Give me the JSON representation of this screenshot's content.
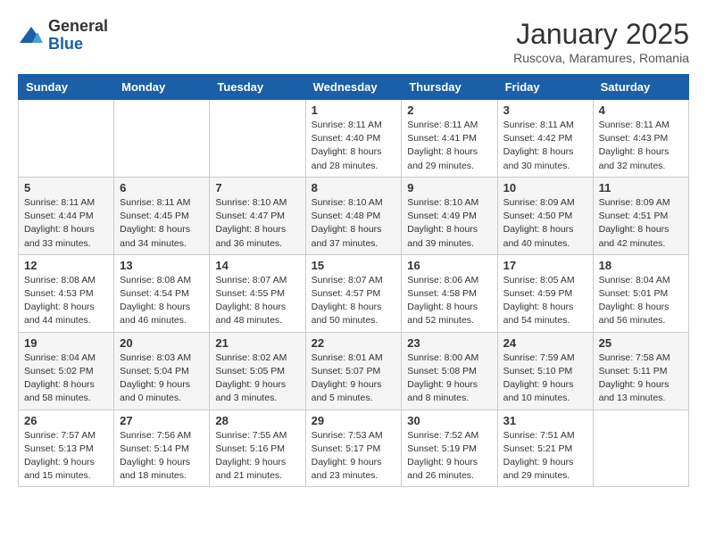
{
  "logo": {
    "general": "General",
    "blue": "Blue"
  },
  "header": {
    "month": "January 2025",
    "location": "Ruscova, Maramures, Romania"
  },
  "weekdays": [
    "Sunday",
    "Monday",
    "Tuesday",
    "Wednesday",
    "Thursday",
    "Friday",
    "Saturday"
  ],
  "weeks": [
    [
      {
        "day": "",
        "info": ""
      },
      {
        "day": "",
        "info": ""
      },
      {
        "day": "",
        "info": ""
      },
      {
        "day": "1",
        "info": "Sunrise: 8:11 AM\nSunset: 4:40 PM\nDaylight: 8 hours\nand 28 minutes."
      },
      {
        "day": "2",
        "info": "Sunrise: 8:11 AM\nSunset: 4:41 PM\nDaylight: 8 hours\nand 29 minutes."
      },
      {
        "day": "3",
        "info": "Sunrise: 8:11 AM\nSunset: 4:42 PM\nDaylight: 8 hours\nand 30 minutes."
      },
      {
        "day": "4",
        "info": "Sunrise: 8:11 AM\nSunset: 4:43 PM\nDaylight: 8 hours\nand 32 minutes."
      }
    ],
    [
      {
        "day": "5",
        "info": "Sunrise: 8:11 AM\nSunset: 4:44 PM\nDaylight: 8 hours\nand 33 minutes."
      },
      {
        "day": "6",
        "info": "Sunrise: 8:11 AM\nSunset: 4:45 PM\nDaylight: 8 hours\nand 34 minutes."
      },
      {
        "day": "7",
        "info": "Sunrise: 8:10 AM\nSunset: 4:47 PM\nDaylight: 8 hours\nand 36 minutes."
      },
      {
        "day": "8",
        "info": "Sunrise: 8:10 AM\nSunset: 4:48 PM\nDaylight: 8 hours\nand 37 minutes."
      },
      {
        "day": "9",
        "info": "Sunrise: 8:10 AM\nSunset: 4:49 PM\nDaylight: 8 hours\nand 39 minutes."
      },
      {
        "day": "10",
        "info": "Sunrise: 8:09 AM\nSunset: 4:50 PM\nDaylight: 8 hours\nand 40 minutes."
      },
      {
        "day": "11",
        "info": "Sunrise: 8:09 AM\nSunset: 4:51 PM\nDaylight: 8 hours\nand 42 minutes."
      }
    ],
    [
      {
        "day": "12",
        "info": "Sunrise: 8:08 AM\nSunset: 4:53 PM\nDaylight: 8 hours\nand 44 minutes."
      },
      {
        "day": "13",
        "info": "Sunrise: 8:08 AM\nSunset: 4:54 PM\nDaylight: 8 hours\nand 46 minutes."
      },
      {
        "day": "14",
        "info": "Sunrise: 8:07 AM\nSunset: 4:55 PM\nDaylight: 8 hours\nand 48 minutes."
      },
      {
        "day": "15",
        "info": "Sunrise: 8:07 AM\nSunset: 4:57 PM\nDaylight: 8 hours\nand 50 minutes."
      },
      {
        "day": "16",
        "info": "Sunrise: 8:06 AM\nSunset: 4:58 PM\nDaylight: 8 hours\nand 52 minutes."
      },
      {
        "day": "17",
        "info": "Sunrise: 8:05 AM\nSunset: 4:59 PM\nDaylight: 8 hours\nand 54 minutes."
      },
      {
        "day": "18",
        "info": "Sunrise: 8:04 AM\nSunset: 5:01 PM\nDaylight: 8 hours\nand 56 minutes."
      }
    ],
    [
      {
        "day": "19",
        "info": "Sunrise: 8:04 AM\nSunset: 5:02 PM\nDaylight: 8 hours\nand 58 minutes."
      },
      {
        "day": "20",
        "info": "Sunrise: 8:03 AM\nSunset: 5:04 PM\nDaylight: 9 hours\nand 0 minutes."
      },
      {
        "day": "21",
        "info": "Sunrise: 8:02 AM\nSunset: 5:05 PM\nDaylight: 9 hours\nand 3 minutes."
      },
      {
        "day": "22",
        "info": "Sunrise: 8:01 AM\nSunset: 5:07 PM\nDaylight: 9 hours\nand 5 minutes."
      },
      {
        "day": "23",
        "info": "Sunrise: 8:00 AM\nSunset: 5:08 PM\nDaylight: 9 hours\nand 8 minutes."
      },
      {
        "day": "24",
        "info": "Sunrise: 7:59 AM\nSunset: 5:10 PM\nDaylight: 9 hours\nand 10 minutes."
      },
      {
        "day": "25",
        "info": "Sunrise: 7:58 AM\nSunset: 5:11 PM\nDaylight: 9 hours\nand 13 minutes."
      }
    ],
    [
      {
        "day": "26",
        "info": "Sunrise: 7:57 AM\nSunset: 5:13 PM\nDaylight: 9 hours\nand 15 minutes."
      },
      {
        "day": "27",
        "info": "Sunrise: 7:56 AM\nSunset: 5:14 PM\nDaylight: 9 hours\nand 18 minutes."
      },
      {
        "day": "28",
        "info": "Sunrise: 7:55 AM\nSunset: 5:16 PM\nDaylight: 9 hours\nand 21 minutes."
      },
      {
        "day": "29",
        "info": "Sunrise: 7:53 AM\nSunset: 5:17 PM\nDaylight: 9 hours\nand 23 minutes."
      },
      {
        "day": "30",
        "info": "Sunrise: 7:52 AM\nSunset: 5:19 PM\nDaylight: 9 hours\nand 26 minutes."
      },
      {
        "day": "31",
        "info": "Sunrise: 7:51 AM\nSunset: 5:21 PM\nDaylight: 9 hours\nand 29 minutes."
      },
      {
        "day": "",
        "info": ""
      }
    ]
  ]
}
